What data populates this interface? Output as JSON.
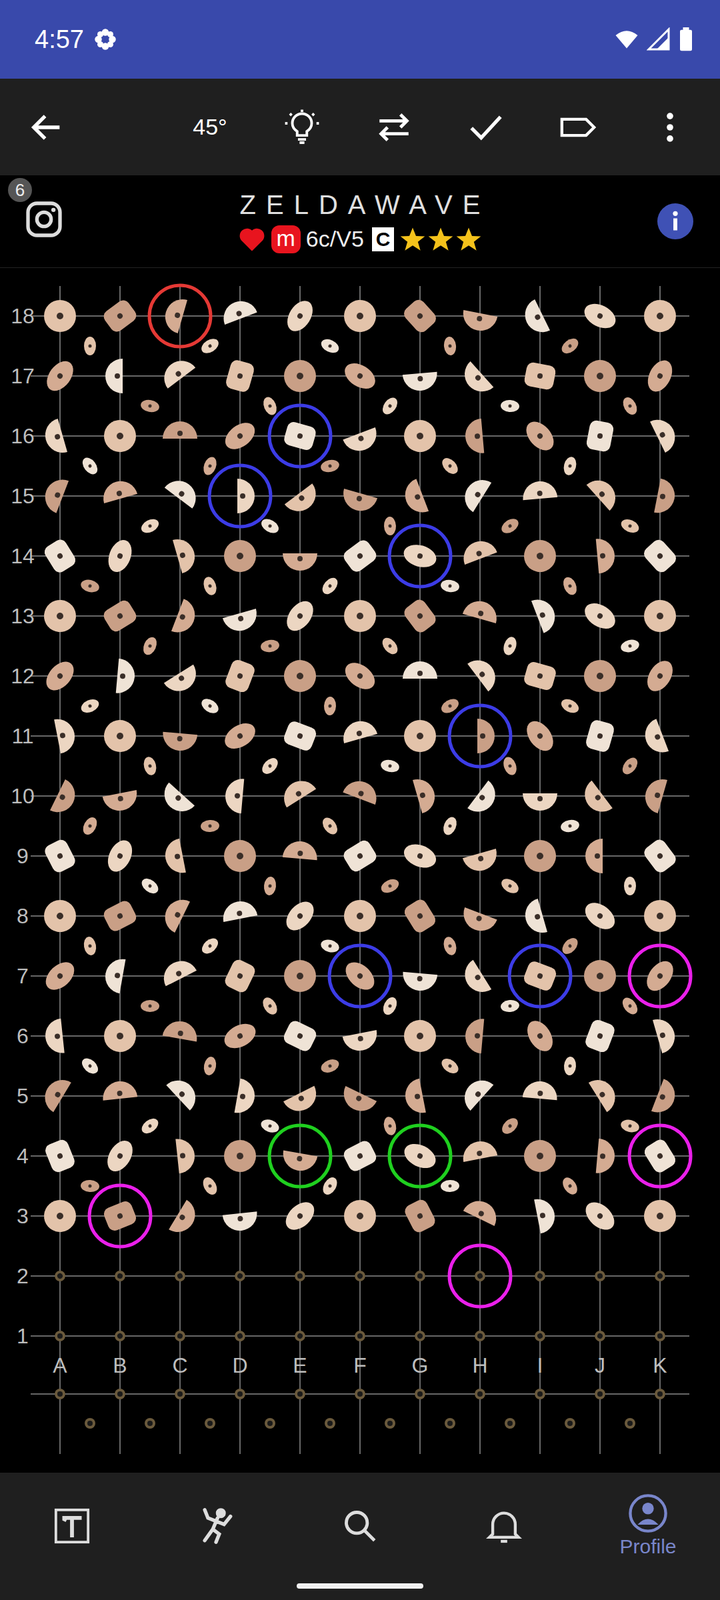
{
  "status_bar": {
    "time": "4:57"
  },
  "toolbar": {
    "angle": "45°"
  },
  "problem": {
    "badge_count": "6",
    "name": "ZELDAWAVE",
    "liked": true,
    "tag": "m",
    "grade": "6c/V5",
    "benchmark": "C",
    "stars": 3
  },
  "board": {
    "columns": [
      "A",
      "B",
      "C",
      "D",
      "E",
      "F",
      "G",
      "H",
      "I",
      "J",
      "K"
    ],
    "rows": [
      "18",
      "17",
      "16",
      "15",
      "14",
      "13",
      "12",
      "11",
      "10",
      "9",
      "8",
      "7",
      "6",
      "5",
      "4",
      "3",
      "2",
      "1"
    ],
    "holds": [
      {
        "column": "C",
        "row": "18",
        "color": "#e53935"
      },
      {
        "column": "E",
        "row": "16",
        "color": "#3c3ce6"
      },
      {
        "column": "D",
        "row": "15",
        "color": "#3c3ce6"
      },
      {
        "column": "G",
        "row": "14",
        "color": "#3c3ce6"
      },
      {
        "column": "H",
        "row": "11",
        "color": "#3c3ce6"
      },
      {
        "column": "F",
        "row": "7",
        "color": "#3c3ce6"
      },
      {
        "column": "I",
        "row": "7",
        "color": "#3c3ce6"
      },
      {
        "column": "K",
        "row": "7",
        "color": "#ea1fea"
      },
      {
        "column": "K",
        "row": "4",
        "color": "#ea1fea"
      },
      {
        "column": "B",
        "row": "3",
        "color": "#ea1fea"
      },
      {
        "column": "H",
        "row": "2",
        "color": "#ea1fea"
      },
      {
        "column": "E",
        "row": "4",
        "color": "#1fd01f"
      },
      {
        "column": "G",
        "row": "4",
        "color": "#1fd01f"
      }
    ]
  },
  "nav": {
    "items": [
      {
        "kind": "logo",
        "label": "",
        "selected": false
      },
      {
        "kind": "climb",
        "label": "",
        "selected": false
      },
      {
        "kind": "search",
        "label": "",
        "selected": false
      },
      {
        "kind": "notifications",
        "label": "",
        "selected": false
      },
      {
        "kind": "profile",
        "label": "Profile",
        "selected": true
      }
    ]
  }
}
